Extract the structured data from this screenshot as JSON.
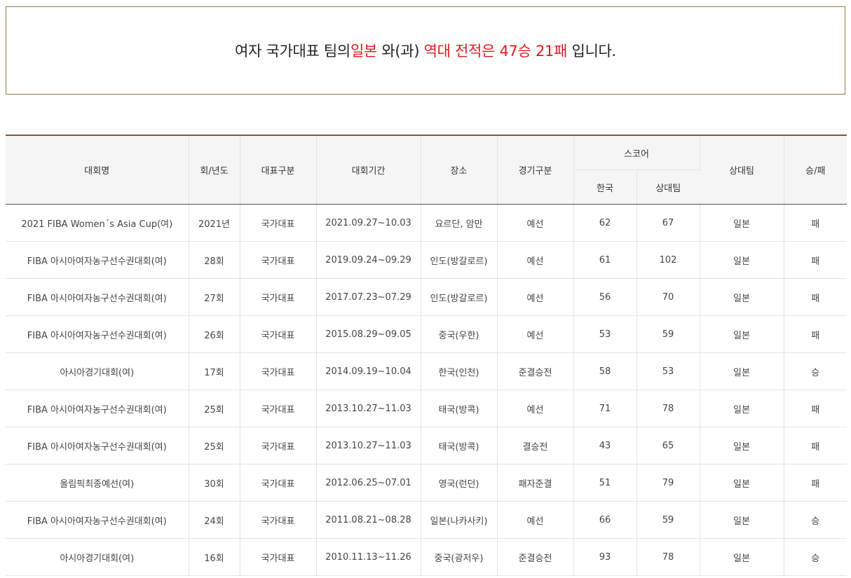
{
  "summary": {
    "prefix": "여자 국가대표 팀의 ",
    "opponent": "일본",
    "middle": " 와(과) ",
    "record_label": "역대 전적은 ",
    "record": "47승 21패",
    "suffix": " 입니다."
  },
  "table": {
    "headers": {
      "tournament": "대회명",
      "edition": "회/년도",
      "team_type": "대표구분",
      "period": "대회기간",
      "venue": "장소",
      "match_type": "경기구분",
      "score": "스코어",
      "score_korea": "한국",
      "score_opponent": "상대팀",
      "opponent": "상대팀",
      "result": "승/패"
    },
    "rows": [
      {
        "tournament": "2021 FIBA Women´s Asia Cup(여)",
        "edition": "2021년",
        "team_type": "국가대표",
        "period": "2021.09.27~10.03",
        "venue": "요르단, 암만",
        "match_type": "예선",
        "korea": "62",
        "opp_score": "67",
        "opponent": "일본",
        "result": "패"
      },
      {
        "tournament": "FIBA 아시아여자농구선수권대회(여)",
        "edition": "28회",
        "team_type": "국가대표",
        "period": "2019.09.24~09.29",
        "venue": "인도(방갈로르)",
        "match_type": "예선",
        "korea": "61",
        "opp_score": "102",
        "opponent": "일본",
        "result": "패"
      },
      {
        "tournament": "FIBA 아시아여자농구선수권대회(여)",
        "edition": "27회",
        "team_type": "국가대표",
        "period": "2017.07.23~07.29",
        "venue": "인도(방갈로르)",
        "match_type": "예선",
        "korea": "56",
        "opp_score": "70",
        "opponent": "일본",
        "result": "패"
      },
      {
        "tournament": "FIBA 아시아여자농구선수권대회(여)",
        "edition": "26회",
        "team_type": "국가대표",
        "period": "2015.08.29~09.05",
        "venue": "중국(우한)",
        "match_type": "예선",
        "korea": "53",
        "opp_score": "59",
        "opponent": "일본",
        "result": "패"
      },
      {
        "tournament": "아시아경기대회(여)",
        "edition": "17회",
        "team_type": "국가대표",
        "period": "2014.09.19~10.04",
        "venue": "한국(인천)",
        "match_type": "준결승전",
        "korea": "58",
        "opp_score": "53",
        "opponent": "일본",
        "result": "승"
      },
      {
        "tournament": "FIBA 아시아여자농구선수권대회(여)",
        "edition": "25회",
        "team_type": "국가대표",
        "period": "2013.10.27~11.03",
        "venue": "태국(방콕)",
        "match_type": "예선",
        "korea": "71",
        "opp_score": "78",
        "opponent": "일본",
        "result": "패"
      },
      {
        "tournament": "FIBA 아시아여자농구선수권대회(여)",
        "edition": "25회",
        "team_type": "국가대표",
        "period": "2013.10.27~11.03",
        "venue": "태국(방콕)",
        "match_type": "결승전",
        "korea": "43",
        "opp_score": "65",
        "opponent": "일본",
        "result": "패"
      },
      {
        "tournament": "올림픽최종예선(여)",
        "edition": "30회",
        "team_type": "국가대표",
        "period": "2012.06.25~07.01",
        "venue": "영국(런던)",
        "match_type": "패자준결",
        "korea": "51",
        "opp_score": "79",
        "opponent": "일본",
        "result": "패"
      },
      {
        "tournament": "FIBA 아시아여자농구선수권대회(여)",
        "edition": "24회",
        "team_type": "국가대표",
        "period": "2011.08.21~08.28",
        "venue": "일본(나카사키)",
        "match_type": "예선",
        "korea": "66",
        "opp_score": "59",
        "opponent": "일본",
        "result": "승"
      },
      {
        "tournament": "아시아경기대회(여)",
        "edition": "16회",
        "team_type": "국가대표",
        "period": "2010.11.13~11.26",
        "venue": "중국(광저우)",
        "match_type": "준결승전",
        "korea": "93",
        "opp_score": "78",
        "opponent": "일본",
        "result": "승"
      }
    ]
  }
}
